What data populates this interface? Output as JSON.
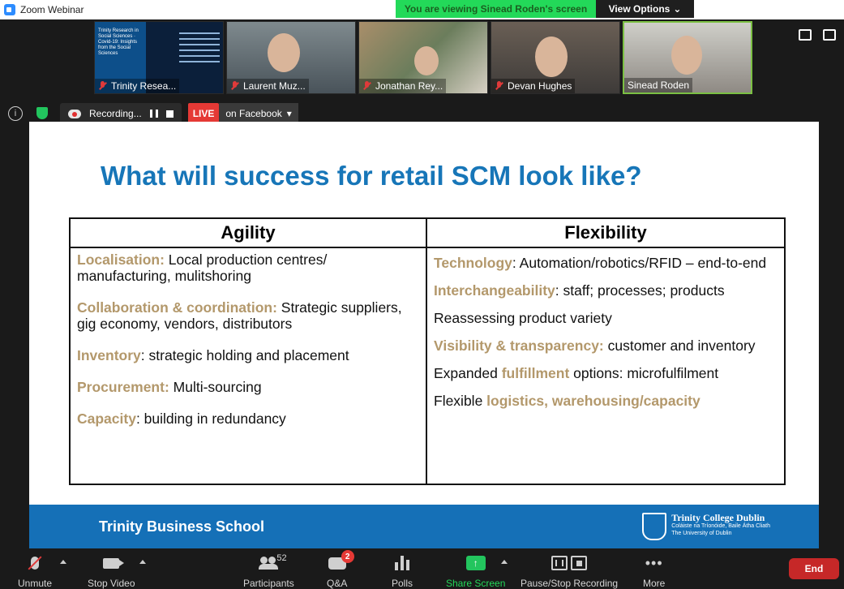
{
  "window": {
    "title": "Zoom Webinar"
  },
  "share_banner": {
    "message": "You are viewing Sinead Roden's screen",
    "view_options": "View Options",
    "caret": "⌄"
  },
  "participants_strip": [
    {
      "name": "Trinity Resea...",
      "muted": true,
      "slide_text": "Trinity Research in Social Sciences · Covid-19: Insights from the Social Sciences"
    },
    {
      "name": "Laurent Muz...",
      "muted": true
    },
    {
      "name": "Jonathan Rey...",
      "muted": true
    },
    {
      "name": "Devan Hughes",
      "muted": true
    },
    {
      "name": "Sinead Roden",
      "muted": false,
      "active": true
    }
  ],
  "recording_bar": {
    "recording_label": "Recording...",
    "live_label": "LIVE",
    "destination": "on Facebook",
    "info": "i"
  },
  "slide": {
    "title": "What will success for retail SCM look like?",
    "columns": [
      {
        "header": "Agility",
        "items": [
          {
            "highlight": "Localisation:",
            "text": " Local production centres/ manufacturing, mulitshoring"
          },
          {
            "highlight": "Collaboration & coordination:",
            "text": " Strategic suppliers, gig economy, vendors, distributors"
          },
          {
            "highlight": "Inventory",
            "text": ": strategic holding and placement"
          },
          {
            "highlight": "Procurement:",
            "text": " Multi-sourcing"
          },
          {
            "highlight": "Capacity",
            "text": ": building in redundancy"
          }
        ]
      },
      {
        "header": "Flexibility",
        "items": [
          {
            "pre": "",
            "highlight": "Technology",
            "text": ": Automation/robotics/RFID – end-to-end"
          },
          {
            "pre": "",
            "highlight": "Interchangeability",
            "text": ": staff; processes; products"
          },
          {
            "pre": "Reassessing product variety",
            "highlight": "",
            "text": ""
          },
          {
            "pre": "",
            "highlight": "Visibility & transparency:",
            "text": " customer and inventory"
          },
          {
            "pre": "Expanded ",
            "highlight": "fulfillment",
            "text": " options: microfulfilment"
          },
          {
            "pre": "Flexible ",
            "highlight": "logistics, warehousing/capacity",
            "text": ""
          }
        ]
      }
    ],
    "footer": {
      "school": "Trinity Business School",
      "college_name": "Trinity College Dublin",
      "college_irish": "Coláiste na Tríonóide, Baile Átha Cliath",
      "college_sub": "The University of Dublin"
    }
  },
  "toolbar": {
    "unmute": "Unmute",
    "stop_video": "Stop Video",
    "participants": "Participants",
    "participants_count": "52",
    "qa": "Q&A",
    "qa_badge": "2",
    "polls": "Polls",
    "share_screen": "Share Screen",
    "share_arrow": "↑",
    "pause_stop_recording": "Pause/Stop Recording",
    "more": "More",
    "more_dots": "•••",
    "end": "End"
  },
  "colors": {
    "accent": "#1776b8",
    "highlight": "#b3986b",
    "live": "#e53935",
    "share": "#23d959"
  }
}
